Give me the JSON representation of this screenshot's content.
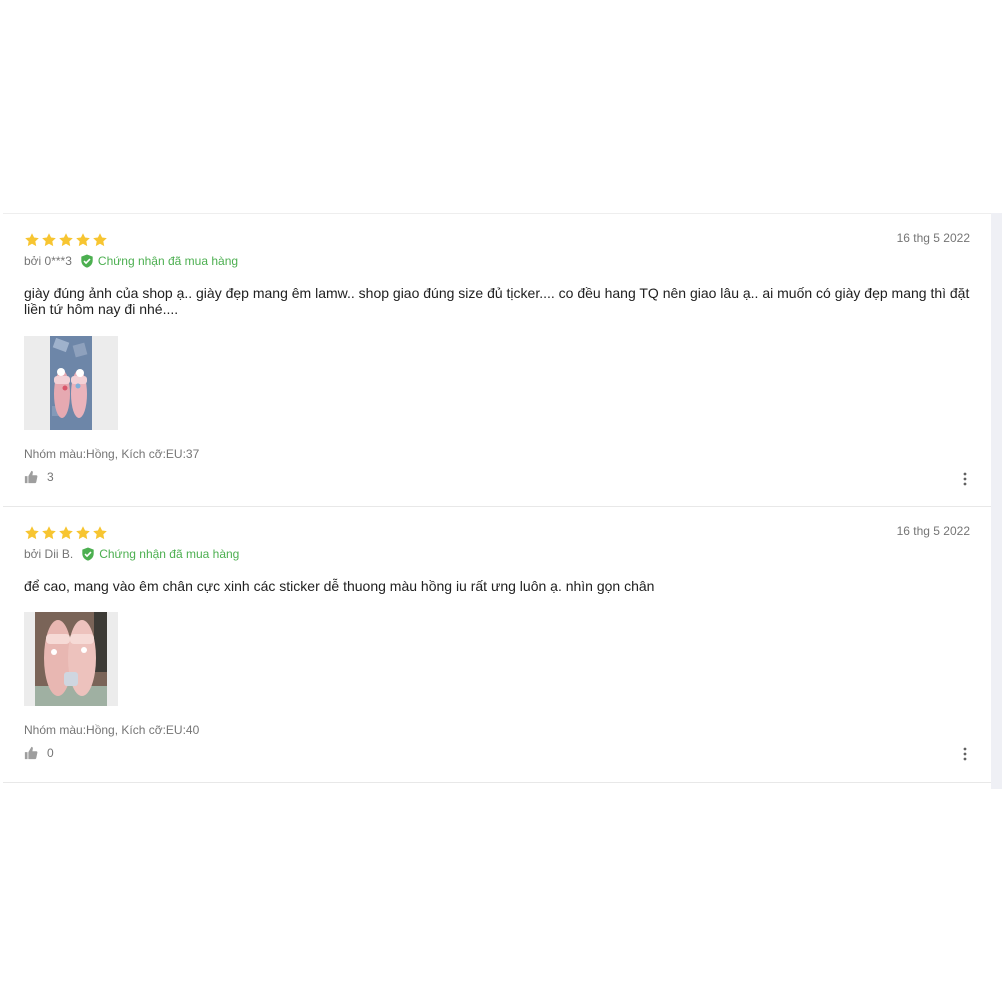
{
  "colors": {
    "star": "#f7c531",
    "verified": "#4caf50",
    "muted_text": "#757575",
    "body_text": "#212121"
  },
  "reviews": [
    {
      "rating": 5,
      "date": "16 thg 5 2022",
      "author": "bởi 0***3",
      "verified_label": "Chứng nhận đã mua hàng",
      "text": "giày đúng ảnh của shop ạ.. giày đẹp mang êm lamw.. shop giao đúng size đủ tịcker.... co đều hang TQ nên giao lâu ạ.. ai muốn có giày đẹp mang thì đặt liền tứ hôm nay đi nhé....",
      "image_icon": "sandal-photo",
      "variant": "Nhóm màu:Hồng, Kích cỡ:EU:37",
      "likes": "3"
    },
    {
      "rating": 5,
      "date": "16 thg 5 2022",
      "author": "bởi Dii B.",
      "verified_label": "Chứng nhận đã mua hàng",
      "text": "để cao, mang vào êm chân cực xinh các sticker dễ thuong màu hồng iu rất ưng luôn ạ. nhìn gọn chân",
      "image_icon": "sandal-photo",
      "variant": "Nhóm màu:Hồng, Kích cỡ:EU:40",
      "likes": "0"
    }
  ]
}
